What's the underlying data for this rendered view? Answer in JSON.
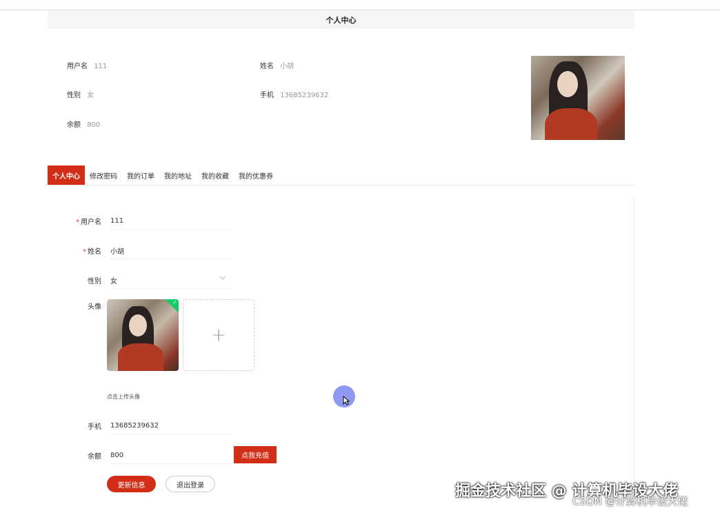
{
  "header": {
    "title": "个人中心"
  },
  "profile": {
    "username_label": "用户名",
    "username": "111",
    "name_label": "姓名",
    "name": "小胡",
    "gender_label": "性别",
    "gender": "女",
    "phone_label": "手机",
    "phone": "13685239632",
    "balance_label": "余额",
    "balance": "800"
  },
  "tabs": [
    "个人中心",
    "修改密码",
    "我的订单",
    "我的地址",
    "我的收藏",
    "我的优惠券"
  ],
  "form": {
    "required_mark": "*",
    "username_label": "用户名",
    "username_value": "111",
    "name_label": "姓名",
    "name_value": "小胡",
    "gender_label": "性别",
    "gender_value": "女",
    "avatar_label": "头像",
    "upload_plus": "+",
    "upload_hint": "点击上传头像",
    "phone_label": "手机",
    "phone_value": "13685239632",
    "balance_label": "余额",
    "balance_value": "800",
    "recharge_button": "点我充值",
    "update_button": "更新信息",
    "logout_button": "退出登录"
  },
  "watermark": {
    "line1": "掘金技术社区 @ 计算机毕设大佬",
    "line2": "CSDN @计算机毕设大佬"
  },
  "colors": {
    "accent": "#d22d16",
    "success": "#13ce66"
  }
}
